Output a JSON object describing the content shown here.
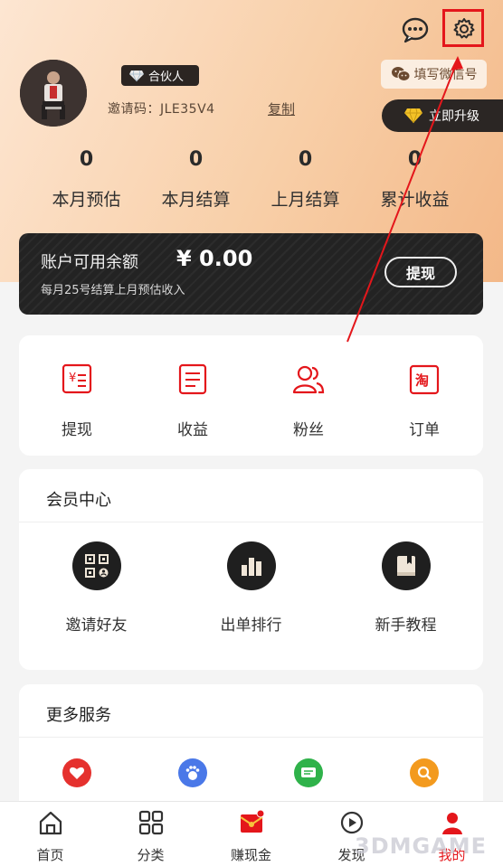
{
  "header": {
    "badge_label": "合伙人",
    "invite_code_label": "邀请码：JLE35V4",
    "copy_label": "复制",
    "wechat_label": "填写微信号",
    "upgrade_label": "立即升级"
  },
  "stats": [
    {
      "value": "0",
      "label": "本月预估"
    },
    {
      "value": "0",
      "label": "本月结算"
    },
    {
      "value": "0",
      "label": "上月结算"
    },
    {
      "value": "0",
      "label": "累计收益"
    }
  ],
  "balance": {
    "title": "账户可用余额",
    "amount": "¥ 0.00",
    "note": "每月25号结算上月预估收入",
    "withdraw_label": "提现"
  },
  "quick_actions": [
    {
      "label": "提现",
      "icon": "withdraw-icon"
    },
    {
      "label": "收益",
      "icon": "income-icon"
    },
    {
      "label": "粉丝",
      "icon": "fans-icon"
    },
    {
      "label": "订单",
      "icon": "order-icon"
    }
  ],
  "member_center": {
    "title": "会员中心",
    "items": [
      {
        "label": "邀请好友",
        "icon": "qr-code-icon"
      },
      {
        "label": "出单排行",
        "icon": "bar-chart-icon"
      },
      {
        "label": "新手教程",
        "icon": "book-icon"
      }
    ]
  },
  "more_services": {
    "title": "更多服务",
    "items": [
      {
        "icon": "heart-icon",
        "color": "#e5312e"
      },
      {
        "icon": "footprint-icon",
        "color": "#4a78e8"
      },
      {
        "icon": "message-icon",
        "color": "#2fb24a"
      },
      {
        "icon": "search-icon",
        "color": "#f39a1e"
      }
    ]
  },
  "bottom_nav": [
    {
      "label": "首页",
      "icon": "home-icon"
    },
    {
      "label": "分类",
      "icon": "grid-icon"
    },
    {
      "label": "赚现金",
      "icon": "red-packet-icon"
    },
    {
      "label": "发现",
      "icon": "discover-icon"
    },
    {
      "label": "我的",
      "icon": "profile-icon",
      "active": true
    }
  ],
  "watermark": "3DMGAME",
  "colors": {
    "accent": "#e4161b",
    "dark_card": "#232323",
    "hero_start": "#fde6d2",
    "hero_end": "#f3b888"
  }
}
